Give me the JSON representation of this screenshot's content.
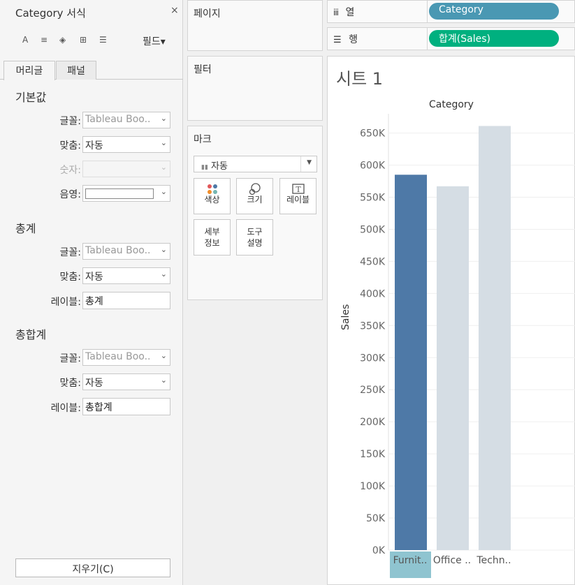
{
  "format_pane": {
    "title": "Category 서식",
    "close": "×",
    "toolbar": {
      "font": "A",
      "align": "≡",
      "shade": "◈",
      "borders": "⊞",
      "lines": "☰"
    },
    "field_menu": "필드▾",
    "tabs": [
      "머리글",
      "패널"
    ],
    "default_section": {
      "heading": "기본값",
      "font_label": "글꼴:",
      "font_value": "Tableau Boo..",
      "align_label": "맞춤:",
      "align_value": "자동",
      "number_label": "숫자:",
      "shade_label": "음영:"
    },
    "totals_section": {
      "heading": "총계",
      "font_label": "글꼴:",
      "font_value": "Tableau Boo..",
      "align_label": "맞춤:",
      "align_value": "자동",
      "label_label": "레이블:",
      "label_value": "총계"
    },
    "grand_totals_section": {
      "heading": "총합계",
      "font_label": "글꼴:",
      "font_value": "Tableau Boo..",
      "align_label": "맞춤:",
      "align_value": "자동",
      "label_label": "레이블:",
      "label_value": "총합계"
    },
    "clear_button": "지우기(C)"
  },
  "pages_card": {
    "label": "페이지"
  },
  "filters_card": {
    "label": "필터"
  },
  "marks_card": {
    "label": "마크",
    "mark_type": "자동",
    "buttons": {
      "color": "색상",
      "size": "크기",
      "label": "레이블",
      "detail": [
        "세부",
        "정보"
      ],
      "tooltip": [
        "도구",
        "설명"
      ]
    }
  },
  "columns_shelf": {
    "label": "열",
    "pill": "Category",
    "pill_color": "#4a98b3"
  },
  "rows_shelf": {
    "label": "행",
    "pill": "합계(Sales)",
    "pill_color": "#00b07f"
  },
  "sheet": {
    "title": "시트 1"
  },
  "chart_data": {
    "type": "bar",
    "title": "Category",
    "ylabel": "Sales",
    "categories": [
      "Furnit..",
      "Office ..",
      "Techn.."
    ],
    "values": [
      585000,
      567000,
      661000
    ],
    "ylim": [
      0,
      680000
    ],
    "yticks": [
      0,
      50000,
      100000,
      150000,
      200000,
      250000,
      300000,
      350000,
      400000,
      450000,
      500000,
      550000,
      600000,
      650000
    ],
    "ytick_labels": [
      "0K",
      "50K",
      "100K",
      "150K",
      "200K",
      "250K",
      "300K",
      "350K",
      "400K",
      "450K",
      "500K",
      "550K",
      "600K",
      "650K"
    ],
    "bar_colors": [
      "#4e79a7",
      "#d5dde4",
      "#d5dde4"
    ],
    "highlight_header_color": "#8fc4d0",
    "grid": true
  }
}
